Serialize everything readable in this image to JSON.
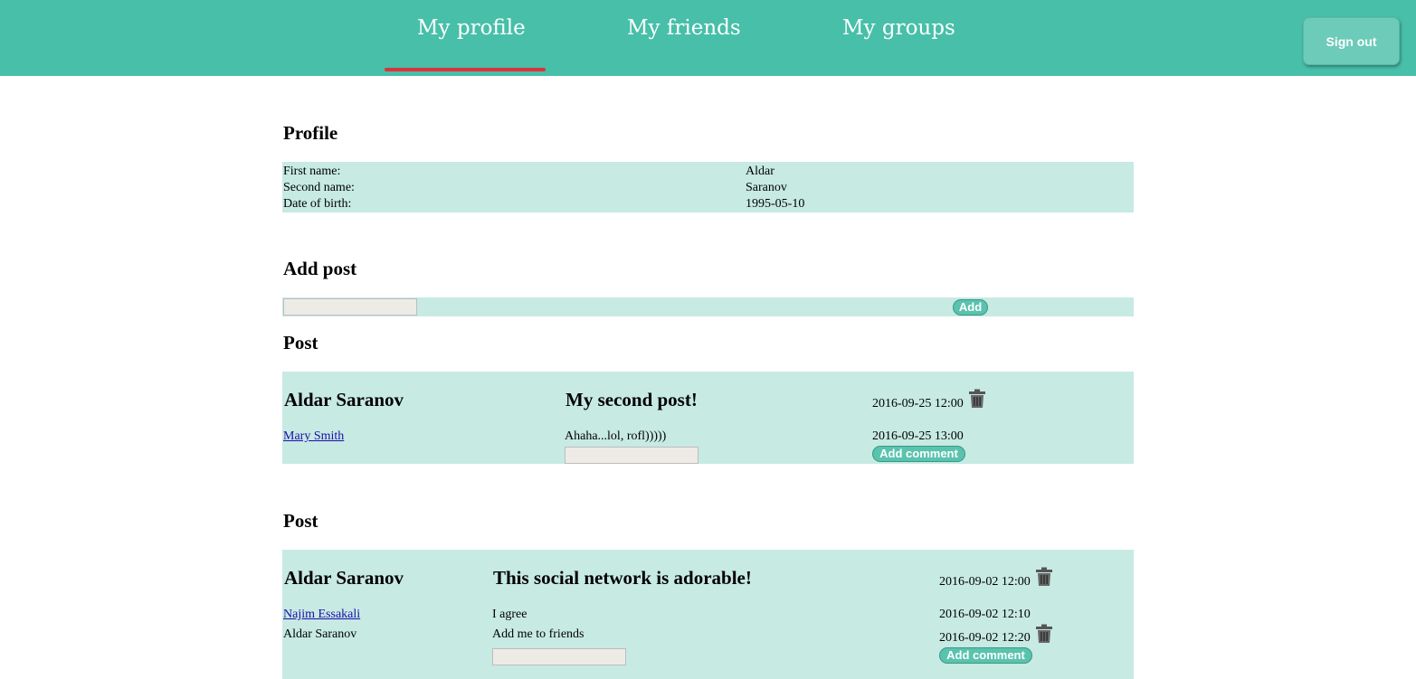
{
  "nav": {
    "tabs": [
      {
        "label": "My profile",
        "active": true
      },
      {
        "label": "My friends",
        "active": false
      },
      {
        "label": "My groups",
        "active": false
      }
    ],
    "sign_out_label": "Sign out"
  },
  "colors": {
    "header": "#47bfa9",
    "panel": "#c7eae3",
    "active_tab_underline": "#e0303b",
    "button": "#5ac3ae"
  },
  "profile": {
    "heading": "Profile",
    "fields": [
      {
        "label": "First name:",
        "value": "Aldar"
      },
      {
        "label": "Second name:",
        "value": "Saranov"
      },
      {
        "label": "Date of birth:",
        "value": "1995-05-10"
      }
    ]
  },
  "add_post": {
    "heading": "Add post",
    "input_value": "",
    "add_label": "Add"
  },
  "posts": [
    {
      "heading": "Post",
      "author": "Aldar Saranov",
      "text": "My second post!",
      "time": "2016-09-25 12:00",
      "delete_icon": "trash-icon",
      "comments": [
        {
          "author": "Mary Smith",
          "text": "Ahaha...lol, rofl)))))",
          "time": "2016-09-25 13:00"
        }
      ],
      "comment_input_value": "",
      "add_comment_label": "Add comment"
    },
    {
      "heading": "Post",
      "author": "Aldar Saranov",
      "text": "This social network is adorable!",
      "time": "2016-09-02 12:00",
      "delete_icon": "trash-icon",
      "comments": [
        {
          "author": "Najim Essakali",
          "text": "I agree",
          "time": "2016-09-02 12:10"
        },
        {
          "author": "Aldar Saranov",
          "text": "Add me to friends",
          "time": "2016-09-02 12:20"
        }
      ],
      "comment_input_value": "",
      "add_comment_label": "Add comment"
    }
  ]
}
